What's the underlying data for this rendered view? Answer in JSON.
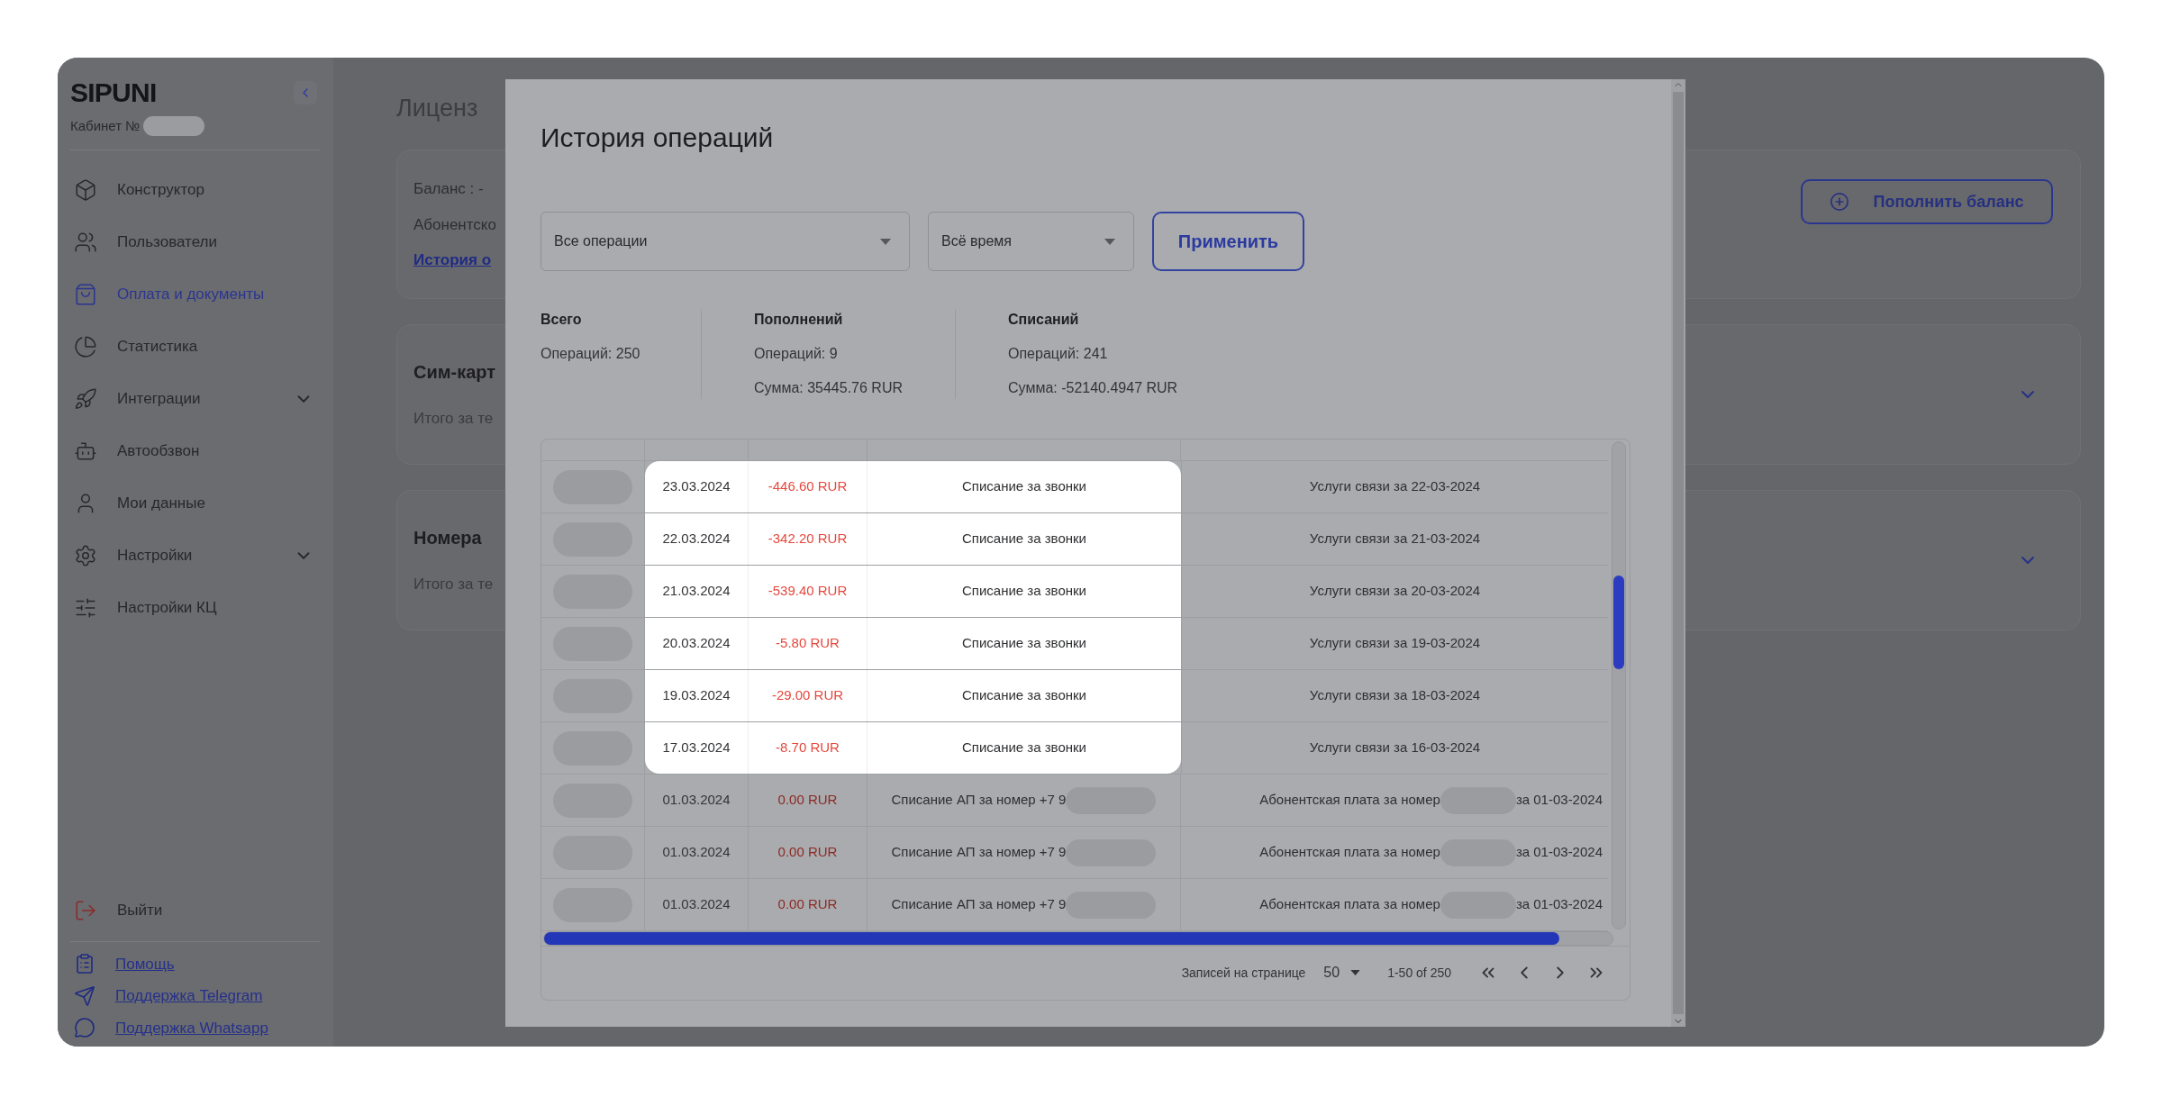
{
  "sidebar": {
    "logo": "SIPUNI",
    "account_label": "Кабинет №",
    "items": [
      {
        "label": "Конструктор",
        "selected": false,
        "expandable": false
      },
      {
        "label": "Пользователи",
        "selected": false,
        "expandable": false
      },
      {
        "label": "Оплата и документы",
        "selected": true,
        "expandable": false
      },
      {
        "label": "Статистика",
        "selected": false,
        "expandable": false
      },
      {
        "label": "Интеграции",
        "selected": false,
        "expandable": true
      },
      {
        "label": "Автообзвон",
        "selected": false,
        "expandable": false
      },
      {
        "label": "Мои данные",
        "selected": false,
        "expandable": false
      },
      {
        "label": "Настройки",
        "selected": false,
        "expandable": true
      },
      {
        "label": "Настройки КЦ",
        "selected": false,
        "expandable": false
      }
    ],
    "logout": "Выйти",
    "links": [
      "Помощь",
      "Поддержка Telegram",
      "Поддержка Whatsapp"
    ]
  },
  "main": {
    "title": "Лиценз",
    "balance_label": "Баланс : -",
    "subscription_label": "Абонентско",
    "history_link": "История о",
    "topup_button": "Пополнить баланс",
    "sections": [
      {
        "title": "Сим-карт",
        "subtitle": "Итого за те"
      },
      {
        "title": "Номера",
        "subtitle": "Итого за те"
      }
    ]
  },
  "modal": {
    "title": "История операций",
    "filters": [
      {
        "value": "Все операции"
      },
      {
        "value": "Всё время"
      }
    ],
    "apply_button": "Применить",
    "stats": [
      {
        "title": "Всего",
        "lines": [
          "Операций: 250"
        ]
      },
      {
        "title": "Пополнений",
        "lines": [
          "Операций: 9",
          "Сумма: 35445.76 RUR"
        ]
      },
      {
        "title": "Списаний",
        "lines": [
          "Операций: 241",
          "Сумма: -52140.4947 RUR"
        ]
      }
    ],
    "rows": [
      {
        "kind": "calls",
        "date": "23.03.2024",
        "amount": "-446.60 RUR",
        "description": "Списание за звонки",
        "comment": "Услуги связи за 22-03-2024",
        "highlighted": true
      },
      {
        "kind": "calls",
        "date": "22.03.2024",
        "amount": "-342.20 RUR",
        "description": "Списание за звонки",
        "comment": "Услуги связи за 21-03-2024",
        "highlighted": true
      },
      {
        "kind": "calls",
        "date": "21.03.2024",
        "amount": "-539.40 RUR",
        "description": "Списание за звонки",
        "comment": "Услуги связи за 20-03-2024",
        "highlighted": true
      },
      {
        "kind": "calls",
        "date": "20.03.2024",
        "amount": "-5.80 RUR",
        "description": "Списание за звонки",
        "comment": "Услуги связи за 19-03-2024",
        "highlighted": true
      },
      {
        "kind": "calls",
        "date": "19.03.2024",
        "amount": "-29.00 RUR",
        "description": "Списание за звонки",
        "comment": "Услуги связи за 18-03-2024",
        "highlighted": true
      },
      {
        "kind": "calls",
        "date": "17.03.2024",
        "amount": "-8.70 RUR",
        "description": "Списание за звонки",
        "comment": "Услуги связи за 16-03-2024",
        "highlighted": true
      },
      {
        "kind": "number",
        "date": "01.03.2024",
        "amount": "0.00 RUR",
        "description": "Списание АП за номер +7 9",
        "comment": "Абонентская плата за номер",
        "comment_suffix": "за 01-03-2024",
        "highlighted": false
      },
      {
        "kind": "number",
        "date": "01.03.2024",
        "amount": "0.00 RUR",
        "description": "Списание АП за номер +7 9",
        "comment": "Абонентская плата за номер",
        "comment_suffix": "за 01-03-2024",
        "highlighted": false
      },
      {
        "kind": "number",
        "date": "01.03.2024",
        "amount": "0.00 RUR",
        "description": "Списание АП за номер +7 9",
        "comment": "Абонентская плата за номер",
        "comment_suffix": "за 01-03-2024",
        "highlighted": false
      }
    ],
    "scroll": {
      "level": 0.95
    },
    "pagination": {
      "per_page_label": "Записей на странице",
      "per_page": "50",
      "range": "1-50 of 250"
    }
  }
}
